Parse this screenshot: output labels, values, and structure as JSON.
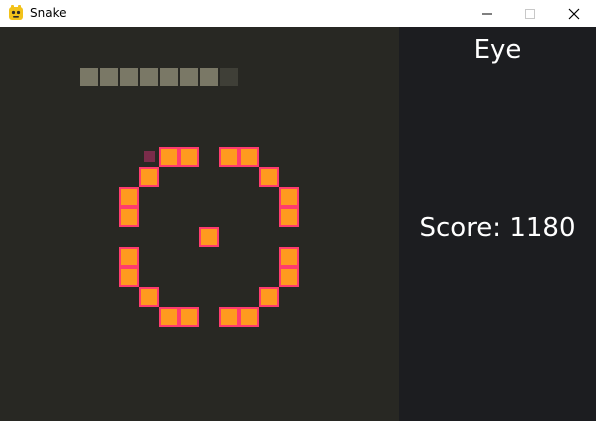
{
  "window": {
    "title": "Snake",
    "icon": "pygame-snake-icon"
  },
  "colors": {
    "game_background": "#282823",
    "panel_background": "#1c1d20",
    "snake_fill": "#ff9a1f",
    "snake_border": "#ff3c6e",
    "food": "#7a2c4a",
    "progress_filled": "#7a7866",
    "progress_empty": "#3f3f37",
    "text": "#ffffff"
  },
  "panel": {
    "mode": "Eye",
    "score": "Score: 1180"
  },
  "progress": {
    "filled": 7,
    "total": 8
  }
}
